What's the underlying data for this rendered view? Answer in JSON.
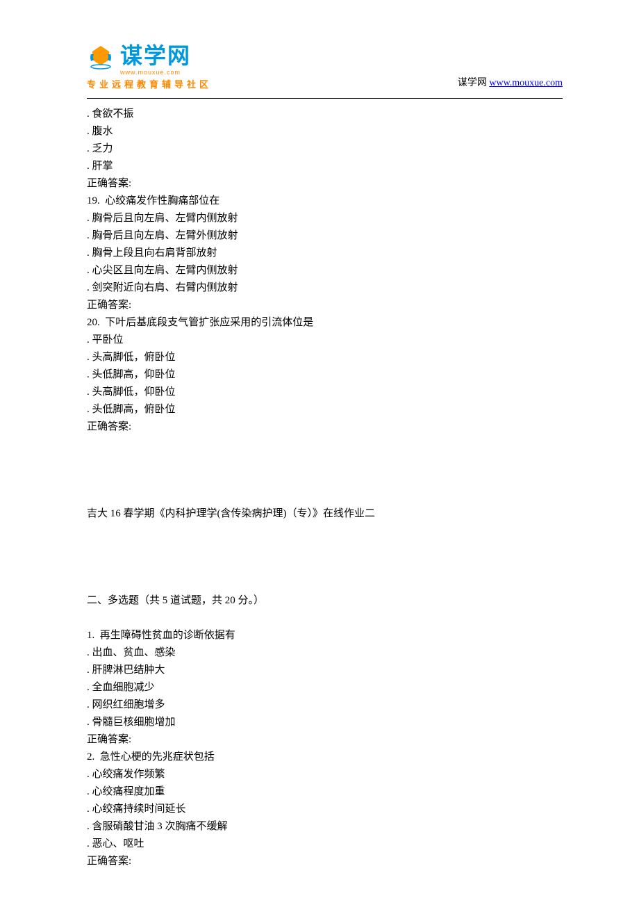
{
  "header": {
    "logo_text": "谋学网",
    "logo_sub": "www.mouxue.com",
    "logo_tagline": "专业远程教育辅导社区",
    "right_text": "谋学网 ",
    "right_link": "www.mouxue.com"
  },
  "lines": [
    ". 食欲不振",
    ". 腹水",
    ". 乏力",
    ". 肝掌",
    "正确答案:",
    "19.  心绞痛发作性胸痛部位在",
    ". 胸骨后且向左肩、左臂内侧放射",
    ". 胸骨后且向左肩、左臂外侧放射",
    ". 胸骨上段且向右肩背部放射",
    ". 心尖区且向左肩、左臂内侧放射",
    ". 剑突附近向右肩、右臂内侧放射",
    "正确答案:",
    "20.  下叶后基底段支气管扩张应采用的引流体位是",
    ". 平卧位",
    ". 头高脚低，俯卧位",
    ". 头低脚高，仰卧位",
    ". 头高脚低，仰卧位",
    ". 头低脚高，俯卧位",
    "正确答案:",
    "",
    "",
    "",
    "",
    "吉大 16 春学期《内科护理学(含传染病护理)（专）》在线作业二",
    "",
    "",
    "",
    "",
    "二、多选题（共 5 道试题，共 20 分。）",
    "",
    "1.  再生障碍性贫血的诊断依据有",
    ". 出血、贫血、感染",
    ". 肝脾淋巴结肿大",
    ". 全血细胞减少",
    ". 网织红细胞增多",
    ". 骨髓巨核细胞增加",
    "正确答案:",
    "2.  急性心梗的先兆症状包括",
    ". 心绞痛发作频繁",
    ". 心绞痛程度加重",
    ". 心绞痛持续时间延长",
    ". 含服硝酸甘油 3 次胸痛不缓解",
    ". 恶心、呕吐",
    "正确答案:"
  ]
}
